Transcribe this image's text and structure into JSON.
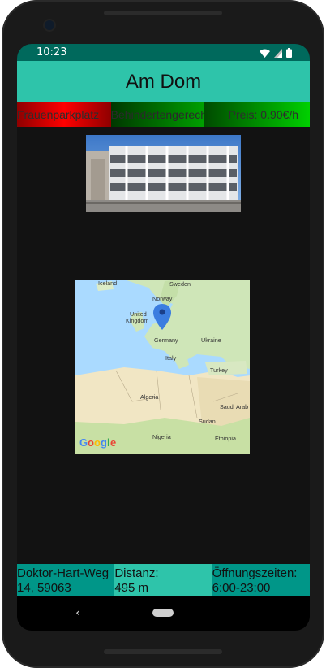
{
  "status": {
    "time": "10:23"
  },
  "app": {
    "title": "Am Dom"
  },
  "tags": {
    "women_parking": "Frauenparkplatz",
    "disabled_access": "Behindertengerecht",
    "price": "Preis: 0.90€/h"
  },
  "map": {
    "labels": [
      "Iceland",
      "Sweden",
      "Norway",
      "United\nKingdom",
      "Germany",
      "Ukraine",
      "Italy",
      "Turkey",
      "Algeria",
      "Saudi Arab",
      "Sudan",
      "Nigeria",
      "Ethiopia"
    ],
    "brand": "Google"
  },
  "info": {
    "address": "Doktor-Hart-Weg 14, 59063",
    "distance_label": "Distanz:",
    "distance_value": "495 m",
    "hours_label": "Öffnungszeiten:",
    "hours_value": "6:00-23:00"
  },
  "colors": {
    "accent": "#2ec4aa",
    "teal_dark": "#009688",
    "statusbar": "#00695c"
  }
}
